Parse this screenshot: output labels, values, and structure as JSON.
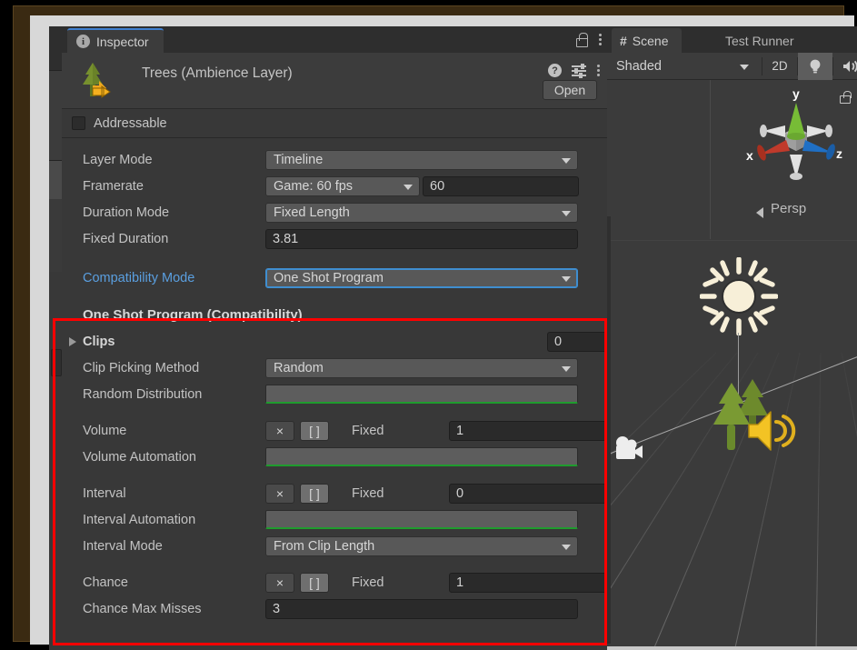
{
  "window": {
    "inspector_tab": {
      "label": "Inspector",
      "icon": "info-icon"
    },
    "scene_tab": {
      "label": "Scene",
      "icon": "grid-hash-icon"
    },
    "test_runner_tab": {
      "label": "Test Runner"
    },
    "lock_icon": "lock-icon",
    "menu_icon": "kebab-menu-icon"
  },
  "inspector": {
    "object_title": "Trees (Ambience Layer)",
    "object_icon": "tree-prefab-icon",
    "help_icon": "help-icon",
    "preset_icon": "preset-sliders-icon",
    "menu_icon": "kebab-menu-icon",
    "open_button": "Open",
    "addressable": {
      "label": "Addressable",
      "checked": false
    },
    "general_rows": [
      {
        "name": "Layer Mode",
        "type": "dropdown",
        "value": "Timeline"
      },
      {
        "name": "Framerate",
        "type": "dropdown-plus-text",
        "value": "Game: 60 fps",
        "value2": "60"
      },
      {
        "name": "Duration Mode",
        "type": "dropdown",
        "value": "Fixed Length"
      },
      {
        "name": "Fixed Duration",
        "type": "text",
        "value": "3.81"
      },
      {
        "name": "Compatibility Mode",
        "type": "dropdown-focused",
        "value": "One Shot Program",
        "accent": true
      }
    ],
    "section": {
      "title": "One Shot Program (Compatibility)",
      "clips": {
        "name": "Clips",
        "value": "0",
        "expanded": false
      },
      "rows": [
        {
          "name": "Clip Picking Method",
          "type": "dropdown",
          "value": "Random"
        },
        {
          "name": "Random Distribution",
          "type": "curve-bar"
        },
        {
          "name": "Volume",
          "type": "fixed-row",
          "btn1": "×",
          "btn2": "[ ]",
          "mode": "Fixed",
          "value": "1"
        },
        {
          "name": "Volume Automation",
          "type": "curve-bar"
        },
        {
          "name": "Interval",
          "type": "fixed-row",
          "btn1": "×",
          "btn2": "[ ]",
          "mode": "Fixed",
          "value": "0"
        },
        {
          "name": "Interval Automation",
          "type": "curve-bar"
        },
        {
          "name": "Interval Mode",
          "type": "dropdown",
          "value": "From Clip Length"
        },
        {
          "name": "Chance",
          "type": "fixed-row",
          "btn1": "×",
          "btn2": "[ ]",
          "mode": "Fixed",
          "value": "1"
        },
        {
          "name": "Chance Max Misses",
          "type": "text",
          "value": "3"
        }
      ]
    },
    "highlight_color": "#ff0000",
    "accent_color": "#5a9fe0",
    "curve_color": "#1f9c2e"
  },
  "scene": {
    "shading_mode": "Shaded",
    "toggle_2d": "2D",
    "lighting_icon": "lightbulb-icon",
    "audio_icon": "speaker-icon",
    "menu_icon": "kebab-menu-icon",
    "gizmo": {
      "x_label": "x",
      "y_label": "y",
      "z_label": "z",
      "projection": "Persp",
      "x_color": "#c03a2b",
      "y_color": "#77bc36",
      "z_color": "#1f6fc4",
      "lock_icon": "lock-icon"
    },
    "objects": [
      {
        "name": "directional-light-gizmo",
        "icon": "sun-icon"
      },
      {
        "name": "trees-object",
        "icon": "tree-icon"
      },
      {
        "name": "audio-source-gizmo",
        "icon": "speaker-icon"
      },
      {
        "name": "camera-gizmo",
        "icon": "camera-icon"
      }
    ]
  }
}
